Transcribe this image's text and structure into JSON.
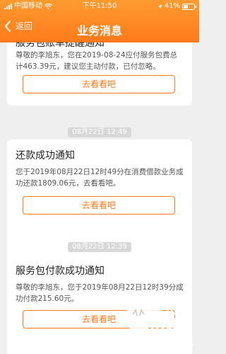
{
  "status_bar": {
    "carrier": "中国移动",
    "time": "下午11:50",
    "battery": "41%",
    "battery_level": 0.41
  },
  "navbar": {
    "back_label": "返回",
    "title": "业务消息"
  },
  "messages": [
    {
      "title": "服务包账单提醒通知",
      "body": "尊敬的李旭东，您在2019-08-24应付服务包费总计463.39元，建议您主动付款，已付忽略。",
      "button": "去看看吧"
    },
    {
      "timestamp": "08月22日 12:49",
      "title": "还款成功通知",
      "body": "您于2019年08月22日12时49分在消费借款业务成功还款1809.06元，去看看吧。",
      "button": "去看看吧"
    },
    {
      "timestamp": "08月22日 12:39",
      "title": "服务包付款成功通知",
      "body": "尊敬的李旭东，您于2019年08月22日12时39分成功付款215.60元。",
      "button": "去看看吧"
    }
  ],
  "watermark": {
    "char": "黑猫",
    "text": "BLACK CAT"
  },
  "colors": {
    "accent": "#ff7a1a",
    "background": "#efefef"
  }
}
